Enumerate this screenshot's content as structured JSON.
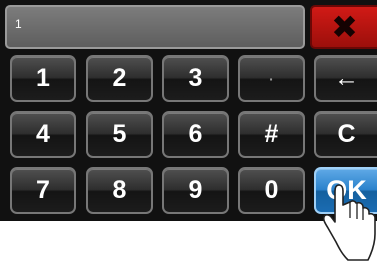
{
  "input": {
    "value": "1"
  },
  "close": {
    "label": "✖"
  },
  "icons": {
    "close": "close-icon",
    "hand": "pointing-hand-icon"
  },
  "keys": {
    "k1": "1",
    "k2": "2",
    "k3": "3",
    "dot": "·",
    "back": "←",
    "k4": "4",
    "k5": "5",
    "k6": "6",
    "hash": "#",
    "clear": "C",
    "k7": "7",
    "k8": "8",
    "k9": "9",
    "k0": "0",
    "ok": "OK"
  },
  "colors": {
    "close": "#c4130f",
    "ok_highlight": "#2b82cc",
    "panel": "#111111"
  }
}
